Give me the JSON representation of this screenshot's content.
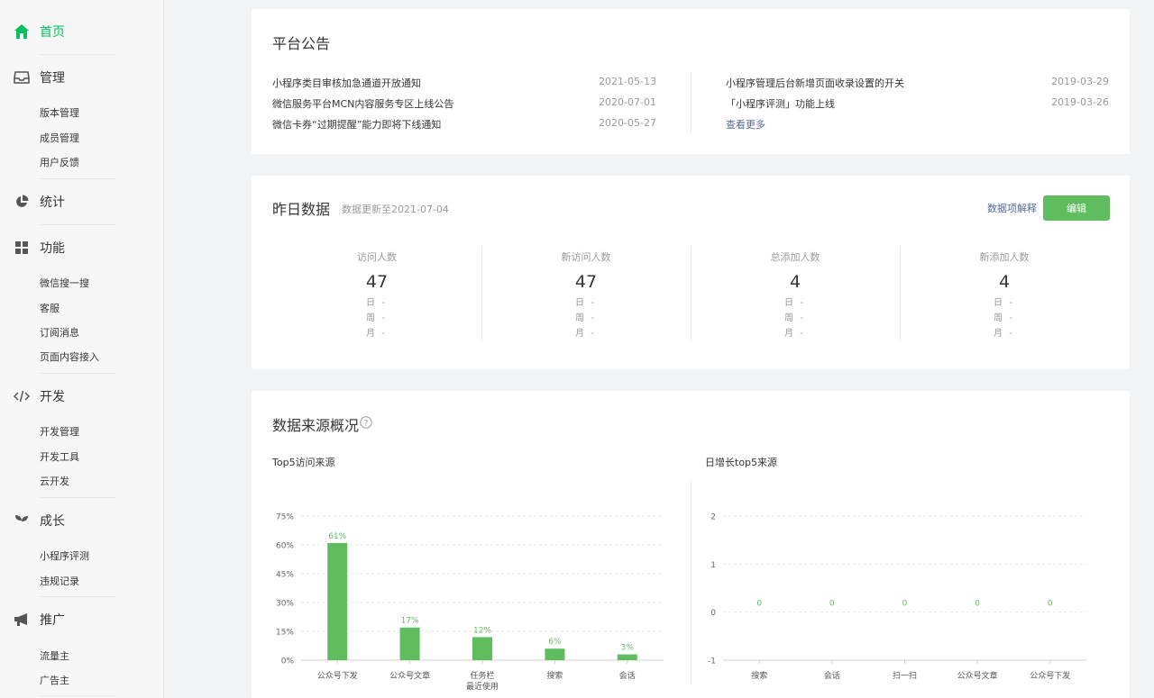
{
  "sidebar": {
    "home": "首页",
    "manage": {
      "label": "管理",
      "items": [
        "版本管理",
        "成员管理",
        "用户反馈"
      ]
    },
    "stats": {
      "label": "统计"
    },
    "features": {
      "label": "功能",
      "items": [
        "微信搜一搜",
        "客服",
        "订阅消息",
        "页面内容接入"
      ]
    },
    "dev": {
      "label": "开发",
      "items": [
        "开发管理",
        "开发工具",
        "云开发"
      ]
    },
    "growth": {
      "label": "成长",
      "items": [
        "小程序评测",
        "违规记录"
      ]
    },
    "promo": {
      "label": "推广",
      "items": [
        "流量主",
        "广告主"
      ]
    }
  },
  "notice": {
    "title": "平台公告",
    "left": [
      {
        "text": "小程序类目审核加急通道开放通知",
        "date": "2021-05-13"
      },
      {
        "text": "微信服务平台MCN内容服务专区上线公告",
        "date": "2020-07-01"
      },
      {
        "text": "微信卡券“过期提醒”能力即将下线通知",
        "date": "2020-05-27"
      }
    ],
    "right": [
      {
        "text": "小程序管理后台新增页面收录设置的开关",
        "date": "2019-03-29"
      },
      {
        "text": "「小程序评测」功能上线",
        "date": "2019-03-26"
      }
    ],
    "more": "查看更多"
  },
  "yesterday": {
    "title": "昨日数据",
    "updated": "数据更新至2021-07-04",
    "explain": "数据项解释",
    "edit": "编辑",
    "stats": [
      {
        "label": "访问人数",
        "value": "47"
      },
      {
        "label": "新访问人数",
        "value": "47"
      },
      {
        "label": "总添加人数",
        "value": "4"
      },
      {
        "label": "新添加人数",
        "value": "4"
      }
    ],
    "rows": [
      {
        "k": "日",
        "v": "-"
      },
      {
        "k": "周",
        "v": "-"
      },
      {
        "k": "月",
        "v": "-"
      }
    ]
  },
  "sources": {
    "title": "数据来源概况",
    "help_icon": "question-circle-icon",
    "accent": "#5fbd5f"
  },
  "chart_data": [
    {
      "type": "bar",
      "title": "Top5访问来源",
      "categories": [
        "公众号下发",
        "公众号文章",
        "任务栏\n最近使用",
        "搜索",
        "会话"
      ],
      "values": [
        61,
        17,
        12,
        6,
        3
      ],
      "labels": [
        "61%",
        "17%",
        "12%",
        "6%",
        "3%"
      ],
      "yticks": [
        "0%",
        "15%",
        "30%",
        "45%",
        "60%",
        "75%"
      ],
      "ylim": [
        0,
        75
      ],
      "color": "#5fbd5f"
    },
    {
      "type": "line",
      "title": "日增长top5来源",
      "categories": [
        "搜索",
        "会话",
        "扫一扫",
        "公众号文章",
        "公众号下发"
      ],
      "values": [
        0,
        0,
        0,
        0,
        0
      ],
      "yticks": [
        "-1",
        "0",
        "1",
        "2"
      ],
      "ylim": [
        -1,
        2
      ],
      "color": "#5fbd5f"
    }
  ]
}
